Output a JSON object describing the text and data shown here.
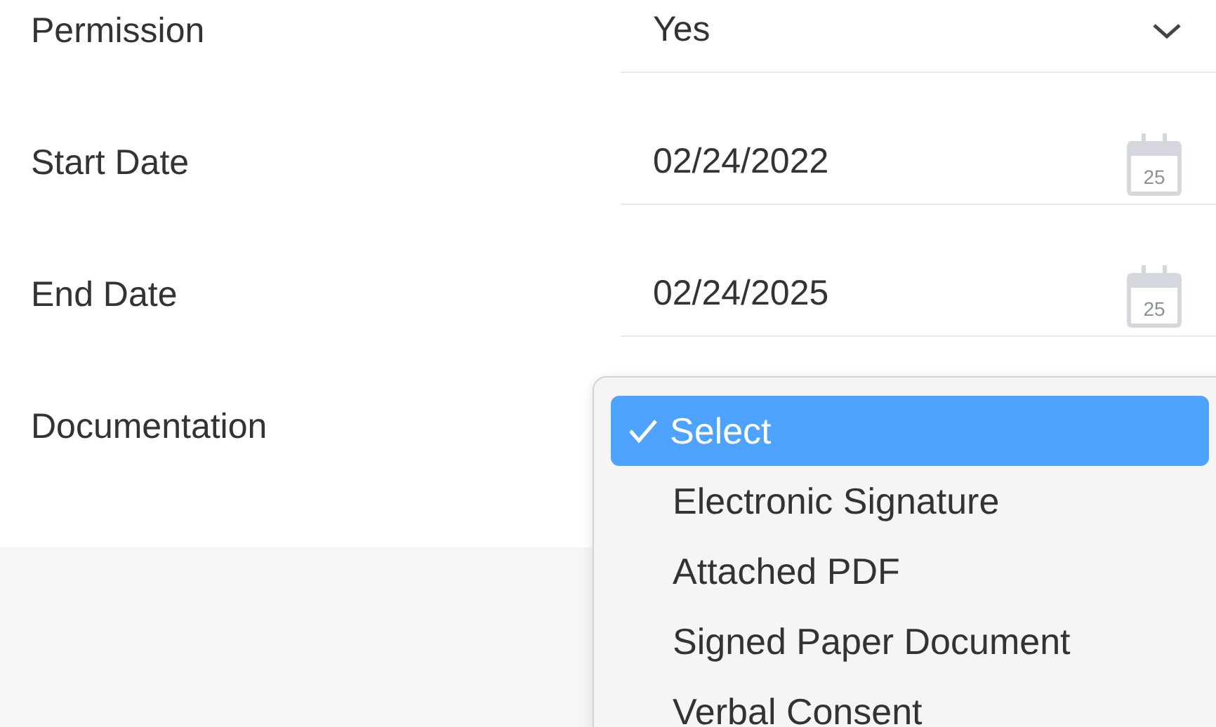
{
  "fields": [
    {
      "label": "Permission",
      "kind": "select",
      "value": "Yes"
    },
    {
      "label": "Start Date",
      "kind": "date",
      "value": "02/24/2022",
      "icon_day": "25"
    },
    {
      "label": "End Date",
      "kind": "date",
      "value": "02/24/2025",
      "icon_day": "25"
    },
    {
      "label": "Documentation",
      "kind": "open-select"
    }
  ],
  "dropdown": {
    "options": [
      {
        "label": "Select",
        "selected": true
      },
      {
        "label": "Electronic Signature",
        "selected": false
      },
      {
        "label": "Attached PDF",
        "selected": false
      },
      {
        "label": "Signed Paper Document",
        "selected": false
      },
      {
        "label": "Verbal Consent",
        "selected": false
      }
    ]
  }
}
